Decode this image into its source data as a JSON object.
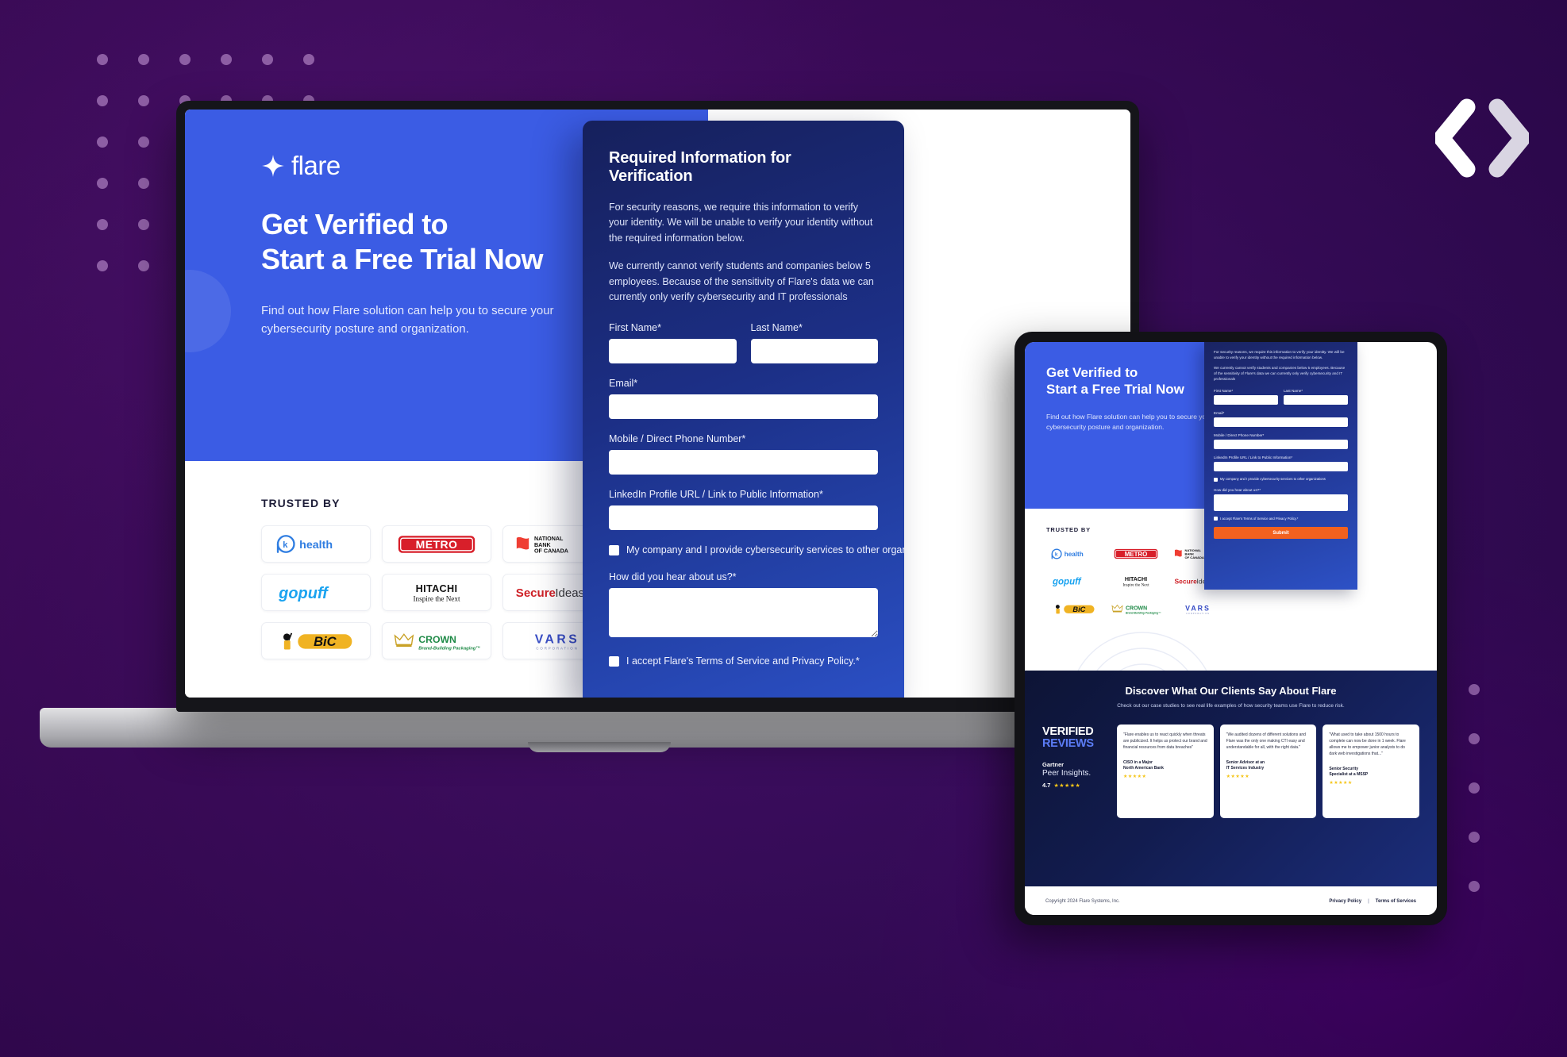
{
  "brand": {
    "name": "flare",
    "logo_icon": "four-point-star-icon"
  },
  "corner_logo": {
    "icon": "x-chevron-logo-icon"
  },
  "hero": {
    "title_line1": "Get Verified to",
    "title_line2": "Start a Free Trial Now",
    "subtitle": "Find out how Flare solution can help you to secure your cybersecurity posture and organization."
  },
  "trusted": {
    "label": "TRUSTED BY",
    "logos": [
      {
        "name": "k health",
        "id": "k-health-logo"
      },
      {
        "name": "METRO",
        "id": "metro-logo"
      },
      {
        "name": "NATIONAL BANK OF CANADA",
        "id": "national-bank-of-canada-logo"
      },
      {
        "name": "gopuff",
        "id": "gopuff-logo"
      },
      {
        "name": "HITACHI Inspire the Next",
        "id": "hitachi-logo"
      },
      {
        "name": "SecureIdeas",
        "id": "secureideas-logo"
      },
      {
        "name": "BIC",
        "id": "bic-logo"
      },
      {
        "name": "CROWN Brand-Building Packaging",
        "id": "crown-logo"
      },
      {
        "name": "VARS CORPORATION",
        "id": "vars-logo"
      }
    ]
  },
  "form": {
    "title": "Required Information for Verification",
    "paragraph1": "For security reasons, we require this  information to verify your identity. We will be unable to verify your  identity without the required information below.",
    "paragraph2": "We currently cannot verify students and companies below 5 employees. Because of the sensitivity of Flare's data we can currently only verify cybersecurity and IT professionals",
    "first_name_label": "First Name*",
    "last_name_label": "Last Name*",
    "email_label": "Email*",
    "phone_label": "Mobile / Direct Phone Number*",
    "linkedin_label": "LinkedIn Profile URL / Link to Public Information*",
    "cyber_checkbox_label": "My company and I provide cybersecurity services to other organizations",
    "hear_about_label": "How did you hear about us?*",
    "terms_checkbox_label": "I accept Flare's Terms of Service and Privacy Policy.*",
    "submit_label": "Submit",
    "first_name_value": "",
    "last_name_value": "",
    "email_value": "",
    "phone_value": "",
    "linkedin_value": "",
    "hear_about_value": "",
    "accent_color": "#f2611f"
  },
  "reviews": {
    "title": "Discover What Our Clients Say About Flare",
    "subtitle": "Check out our case studies to see real life examples of how security teams use Flare to reduce risk.",
    "verified_line1": "VERIFIED",
    "verified_line2": "REVIEWS",
    "source_name": "Gartner",
    "source_sub": "Peer Insights.",
    "rating": "4.7",
    "rating_stars": "★★★★★",
    "cards": [
      {
        "quote": "\"Flare enables us to react quickly when threats are publicized. It helps us protect our brand and financial resources from data breaches\"",
        "author_line1": "CISO in a Major",
        "author_line2": "North American Bank",
        "stars": "★★★★★"
      },
      {
        "quote": "\"We audited dozens of different solutions and Flare was the only one making CTI easy and understandable for all, with the right data.\"",
        "author_line1": "Senior Advisor at an",
        "author_line2": "IT Services Industry",
        "stars": "★★★★★"
      },
      {
        "quote": "\"What used to take about 1500 hours to complete can now be done in 1 week. Flare allows me to empower junior analysts to do dark web investigations that...\"",
        "author_line1": "Senior Security",
        "author_line2": "Specialist at a MSSP",
        "stars": "★★★★★"
      }
    ]
  },
  "footer": {
    "copyright": "Copyright 2024 Flare Systems, Inc.",
    "privacy_label": "Privacy Policy",
    "separator": "|",
    "terms_label": "Terms of Services"
  },
  "colors": {
    "brand_blue": "#3b5ce4",
    "form_navy": "#16205c",
    "background_purple": "#3d0a5c",
    "submit_orange": "#f2611f",
    "star_gold": "#f5c518"
  }
}
